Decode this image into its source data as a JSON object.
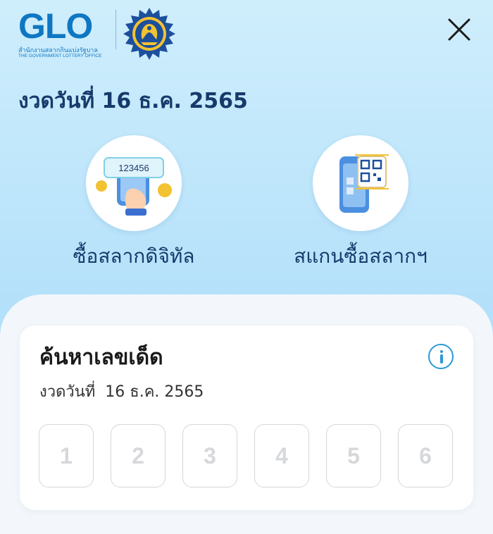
{
  "header": {
    "logo_text": "GLO",
    "logo_thai": "สำนักงานสลากกินแบ่งรัฐบาล",
    "logo_english": "THE GOVERNMENT LOTTERY OFFICE"
  },
  "draw": {
    "title": "งวดวันที่ 16 ธ.ค. 2565"
  },
  "actions": [
    {
      "label": "ซื้อสลากดิจิทัล",
      "icon": "phone-ticket-icon",
      "ticket_number": "123456"
    },
    {
      "label": "สแกนซื้อสลากฯ",
      "icon": "phone-qr-scan-icon"
    }
  ],
  "search": {
    "title": "ค้นหาเลขเด็ด",
    "draw_label": "งวดวันที่",
    "draw_date": "16 ธ.ค. 2565",
    "digit_placeholders": [
      "1",
      "2",
      "3",
      "4",
      "5",
      "6"
    ]
  },
  "colors": {
    "navy_text": "#163a6b",
    "brand_blue": "#0f77c2",
    "accent_blue": "#2b9ad6",
    "gold": "#f4b400"
  }
}
